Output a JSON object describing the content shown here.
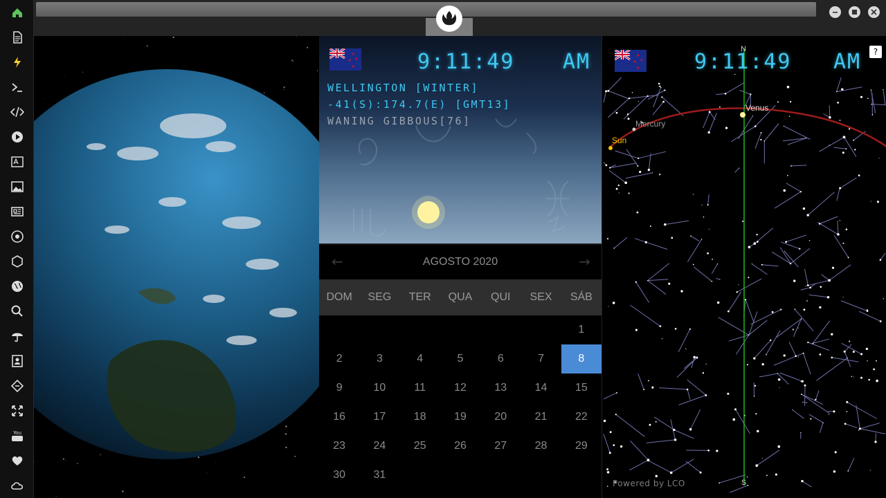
{
  "sidebar": {
    "items": [
      {
        "icon": "home-icon"
      },
      {
        "icon": "document-icon"
      },
      {
        "icon": "lightning-icon"
      },
      {
        "icon": "terminal-icon"
      },
      {
        "icon": "code-icon"
      },
      {
        "icon": "play-icon"
      },
      {
        "icon": "translate-icon"
      },
      {
        "icon": "image-icon"
      },
      {
        "icon": "newspaper-icon"
      },
      {
        "icon": "rebel-alliance-icon"
      },
      {
        "icon": "hexagon-icon"
      },
      {
        "icon": "globe-icon"
      },
      {
        "icon": "search-icon"
      },
      {
        "icon": "umbrella-icon"
      },
      {
        "icon": "contacts-icon"
      },
      {
        "icon": "diamond-link-icon"
      },
      {
        "icon": "expand-icon"
      },
      {
        "icon": "youtube-icon"
      },
      {
        "icon": "heart-icon"
      },
      {
        "icon": "cloud-icon"
      }
    ],
    "accent": "#5cc45c"
  },
  "clock": {
    "time": "9:11:49",
    "ampm": "AM",
    "city": "WELLINGTON [WINTER]",
    "coords": "-41(S):174.7(E) [GMT13]",
    "moon": "WANING GIBBOUS[76]",
    "digit_color": "#3ec8f0"
  },
  "calendar": {
    "month": "AGOSTO 2020",
    "weekdays": [
      "DOM",
      "SEG",
      "TER",
      "QUA",
      "QUI",
      "SEX",
      "SÁB"
    ],
    "days": [
      "1",
      "2",
      "3",
      "4",
      "5",
      "6",
      "7",
      "8",
      "9",
      "10",
      "11",
      "12",
      "13",
      "14",
      "15",
      "16",
      "17",
      "18",
      "19",
      "20",
      "21",
      "22",
      "23",
      "24",
      "25",
      "26",
      "27",
      "28",
      "29",
      "30",
      "31"
    ],
    "selected": "8",
    "selected_color": "#4a8bd6"
  },
  "sky": {
    "north": "N",
    "south": "S",
    "labels": {
      "sun": "Sun",
      "mercury": "Mercury",
      "venus": "Venus"
    },
    "powered": "Powered by LCO",
    "help": "?"
  }
}
